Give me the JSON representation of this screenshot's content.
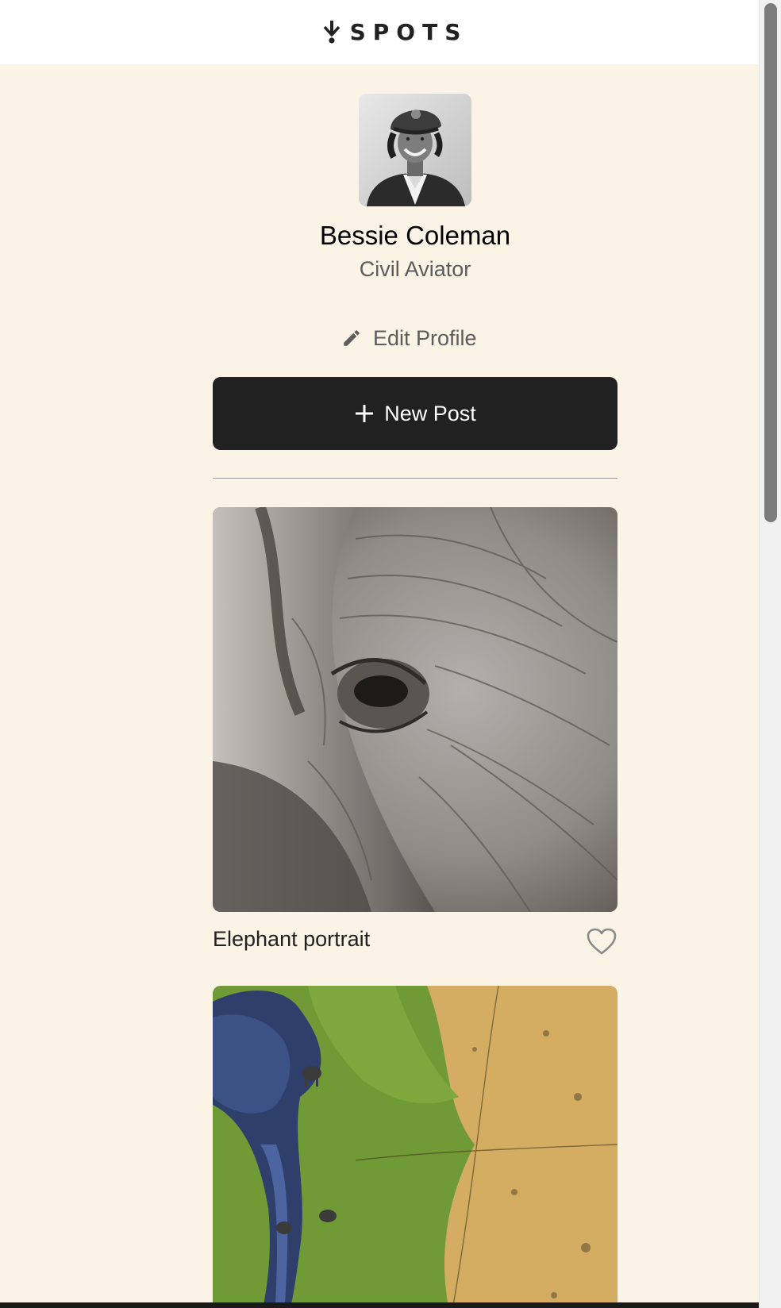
{
  "header": {
    "logo_text": "SPOTS",
    "logo_icon": "spots-logo-icon"
  },
  "profile": {
    "avatar": "profile-avatar-photo",
    "name": "Bessie Coleman",
    "description": "Civil Aviator",
    "edit_label": "Edit Profile",
    "edit_icon": "pencil-icon"
  },
  "actions": {
    "new_post_label": "New Post",
    "new_post_icon": "plus-icon"
  },
  "cards": [
    {
      "title": "Elephant portrait",
      "like_icon": "heart-outline-icon",
      "liked": false,
      "image": "elephant-eye-closeup-photo"
    },
    {
      "title": "",
      "image": "aerial-river-elephants-photo"
    }
  ],
  "colors": {
    "page_background": "#fbf3e5",
    "header_background": "#ffffff",
    "button_background": "#212121",
    "text_primary": "#212121",
    "text_secondary": "#5c5c5c"
  }
}
